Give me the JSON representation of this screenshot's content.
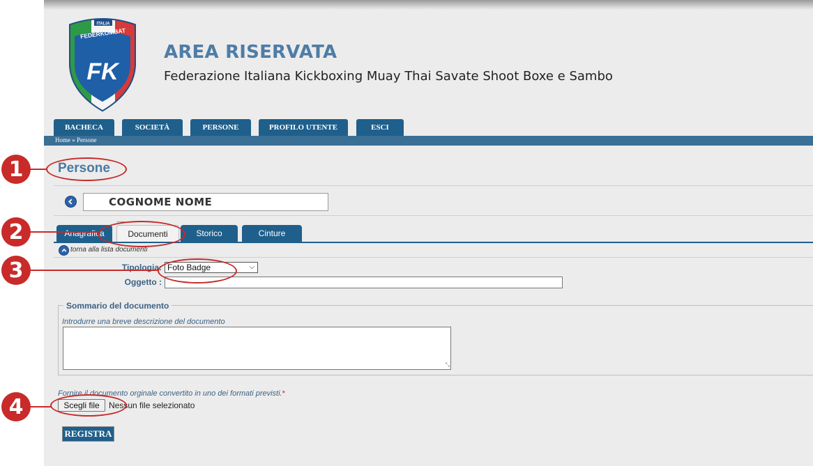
{
  "header": {
    "logo_text": {
      "top": "ITALIA",
      "name": "FEDERKOMBAT",
      "initials": "FK"
    },
    "title": "AREA RISERVATA",
    "subtitle": "Federazione Italiana Kickboxing Muay Thai Savate Shoot Boxe e Sambo"
  },
  "nav": {
    "items": [
      {
        "label": "BACHECA"
      },
      {
        "label": "SOCIETÀ"
      },
      {
        "label": "PERSONE"
      },
      {
        "label": "PROFILO UTENTE"
      },
      {
        "label": "ESCI"
      }
    ],
    "breadcrumb": "Home » Persone"
  },
  "page": {
    "title": "Persone",
    "person_name": "COGNOME NOME",
    "dots": "........"
  },
  "tabs": [
    {
      "label": "Anagrafica"
    },
    {
      "label": "Documenti",
      "active": true
    },
    {
      "label": "Storico"
    },
    {
      "label": "Cinture"
    }
  ],
  "form": {
    "back_link": "torna alla lista documenti",
    "tipologia_label": "Tipologia:",
    "tipologia_value": "Foto Badge",
    "oggetto_label": "Oggetto :",
    "oggetto_value": "",
    "summary_legend": "Sommario del documento",
    "summary_hint": "Introdurre una breve descrizione del documento",
    "summary_value": "",
    "file_hint": "Fornire il documento orginale convertito in uno dei formati previsti.",
    "required_mark": "*",
    "file_button": "Scegli file",
    "file_status": "Nessun file selezionato",
    "submit_label": "REGISTRA"
  },
  "annotations": {
    "markers": [
      "1",
      "2",
      "3",
      "4"
    ],
    "color": "#c92a2a"
  },
  "colors": {
    "nav_blue": "#1f5f8b",
    "title_blue": "#4e7da6",
    "label_blue": "#3b6286",
    "background": "#ececec"
  }
}
